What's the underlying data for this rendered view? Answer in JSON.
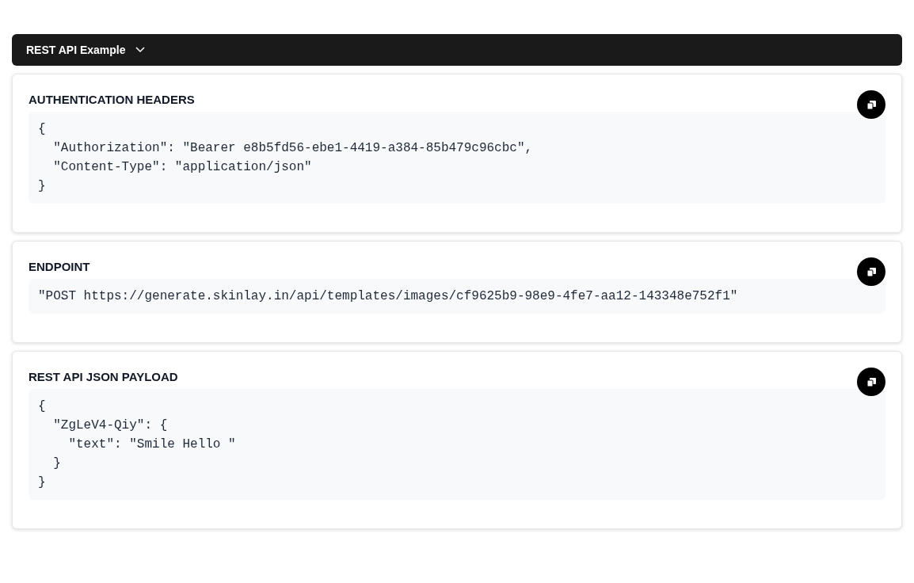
{
  "dropdown": {
    "label": "REST API Example"
  },
  "sections": [
    {
      "title": "AUTHENTICATION HEADERS",
      "code": "{\n  \"Authorization\": \"Bearer e8b5fd56-ebe1-4419-a384-85b479c96cbc\",\n  \"Content-Type\": \"application/json\"\n}"
    },
    {
      "title": "ENDPOINT",
      "code": "\"POST https://generate.skinlay.in/api/templates/images/cf9625b9-98e9-4fe7-aa12-143348e752f1\""
    },
    {
      "title": "REST API JSON PAYLOAD",
      "code": "{\n  \"ZgLeV4-Qiy\": {\n    \"text\": \"Smile Hello \"\n  }\n}"
    }
  ]
}
